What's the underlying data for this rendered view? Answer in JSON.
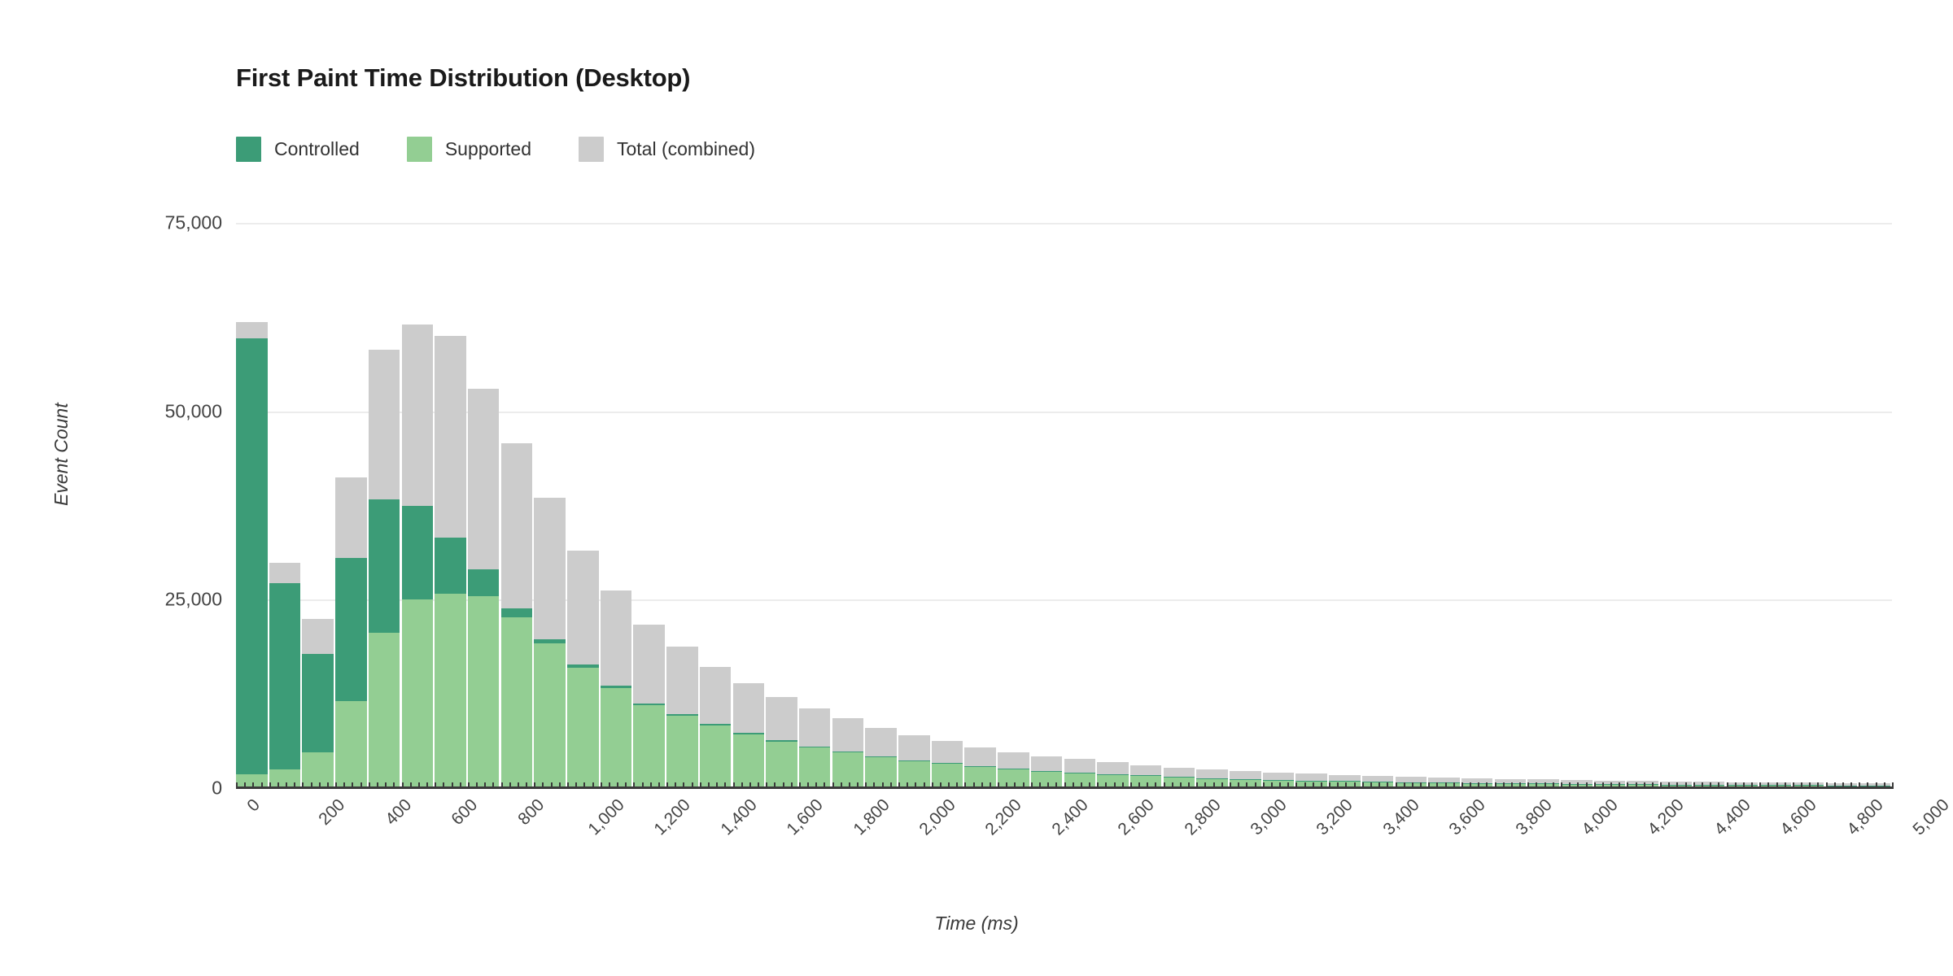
{
  "chart": {
    "title": "First Paint Time Distribution (Desktop)",
    "legend": [
      {
        "label": "Controlled",
        "color": "#3c9c77",
        "key": "controlled"
      },
      {
        "label": "Supported",
        "color": "#93ce93",
        "key": "supported"
      },
      {
        "label": "Total (combined)",
        "color": "#cccccc",
        "key": "total"
      }
    ],
    "y_axis": {
      "label": "Event Count",
      "ticks": [
        "0",
        "25,000",
        "50,000",
        "75,000"
      ],
      "tick_values": [
        0,
        25000,
        50000,
        75000
      ],
      "min": 0,
      "max": 75000
    },
    "x_axis": {
      "label": "Time (ms)",
      "ticks": [
        "0",
        "200",
        "400",
        "600",
        "800",
        "1,000",
        "1,200",
        "1,400",
        "1,600",
        "1,800",
        "2,000",
        "2,200",
        "2,400",
        "2,600",
        "2,800",
        "3,000",
        "3,200",
        "3,400",
        "3,600",
        "3,800",
        "4,000",
        "4,200",
        "4,400",
        "4,600",
        "4,800",
        "5,000"
      ],
      "tick_values": [
        0,
        200,
        400,
        600,
        800,
        1000,
        1200,
        1400,
        1600,
        1800,
        2000,
        2200,
        2400,
        2600,
        2800,
        3000,
        3200,
        3400,
        3600,
        3800,
        4000,
        4200,
        4400,
        4600,
        4800,
        5000
      ],
      "min": 0,
      "max": 5000
    },
    "grid": true,
    "plot_background": "#ffffff"
  },
  "chart_data": {
    "type": "bar",
    "subtype": "stacked-histogram",
    "title": "First Paint Time Distribution (Desktop)",
    "xlabel": "Time (ms)",
    "ylabel": "Event Count",
    "xlim": [
      0,
      5000
    ],
    "ylim": [
      0,
      75000
    ],
    "bin_width": 100,
    "grid": true,
    "legend_position": "top-left",
    "categories": [
      0,
      100,
      200,
      300,
      400,
      500,
      600,
      700,
      800,
      900,
      1000,
      1100,
      1200,
      1300,
      1400,
      1500,
      1600,
      1700,
      1800,
      1900,
      2000,
      2100,
      2200,
      2300,
      2400,
      2500,
      2600,
      2700,
      2800,
      2900,
      3000,
      3100,
      3200,
      3300,
      3400,
      3500,
      3600,
      3700,
      3800,
      3900,
      4000,
      4100,
      4200,
      4300,
      4400,
      4500,
      4600,
      4700,
      4800,
      4900
    ],
    "series": [
      {
        "name": "Supported",
        "color": "#93ce93",
        "values": [
          1800,
          2500,
          4800,
          11500,
          20600,
          25000,
          25800,
          25500,
          22700,
          19200,
          16000,
          13300,
          11000,
          9600,
          8300,
          7100,
          6200,
          5400,
          4700,
          4100,
          3600,
          3200,
          2800,
          2500,
          2200,
          2000,
          1800,
          1600,
          1400,
          1250,
          1150,
          1050,
          950,
          880,
          820,
          760,
          700,
          650,
          610,
          570,
          530,
          500,
          470,
          440,
          410,
          390,
          370,
          350,
          330,
          310
        ]
      },
      {
        "name": "Controlled",
        "color": "#3c9c77",
        "values": [
          57900,
          24700,
          13000,
          19000,
          17700,
          12400,
          7400,
          3500,
          1100,
          500,
          380,
          320,
          270,
          240,
          210,
          190,
          170,
          150,
          140,
          130,
          120,
          110,
          100,
          95,
          90,
          85,
          80,
          75,
          70,
          65,
          60,
          58,
          55,
          52,
          50,
          48,
          45,
          43,
          41,
          39,
          37,
          35,
          34,
          32,
          31,
          30,
          29,
          28,
          27,
          26
        ]
      },
      {
        "name": "Total (combined)",
        "color": "#cccccc",
        "values": [
          2100,
          2700,
          4600,
          10700,
          19900,
          24100,
          26800,
          24000,
          22000,
          18800,
          15100,
          12600,
          10400,
          8900,
          7600,
          6600,
          5700,
          5000,
          4400,
          3800,
          3300,
          2900,
          2500,
          2200,
          1950,
          1750,
          1550,
          1400,
          1250,
          1150,
          1050,
          980,
          900,
          840,
          780,
          720,
          670,
          630,
          590,
          550,
          520,
          490,
          460,
          430,
          400,
          380,
          360,
          340,
          320,
          300
        ]
      }
    ]
  }
}
